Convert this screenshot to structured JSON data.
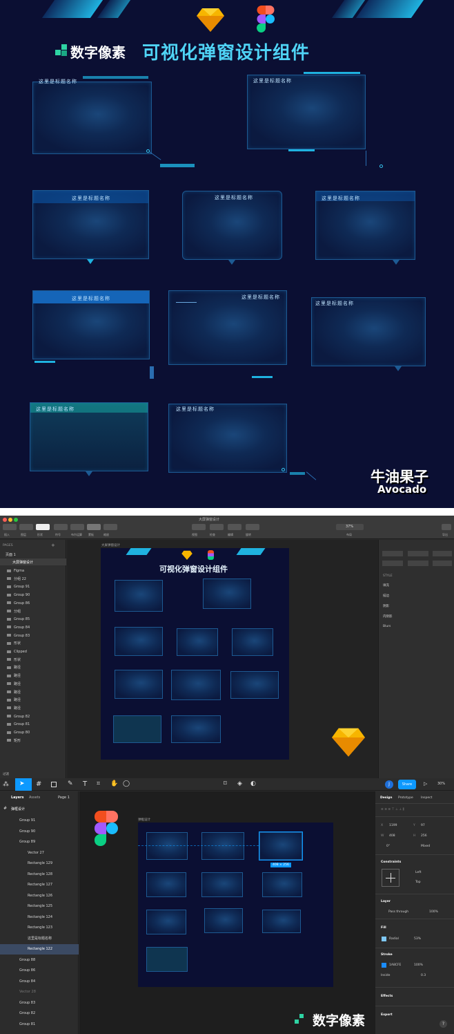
{
  "poster": {
    "brand_name": "数字像素",
    "headline": "可视化弹窗设计组件",
    "frame_title": "这里是标题名称",
    "watermark_line1": "牛油果子",
    "watermark_line2": "Avocado"
  },
  "sketch": {
    "window_title": "大屏弹窗设计",
    "toolbar": [
      "插入",
      "图层",
      "形状",
      "符号",
      "布尔运算",
      "蒙板",
      "缩放",
      "视图",
      "检查",
      "编辑",
      "旋转",
      "变换",
      "布局",
      "更多",
      "显示",
      "导出"
    ],
    "zoom": "37%",
    "pages_header": "PAGES",
    "page_name": "页面 1",
    "artboard_name": "大屏弹窗设计",
    "layers": [
      "Figma",
      "分组 22",
      "Group 91",
      "Group 90",
      "Group 86",
      "分组",
      "Group 85",
      "Group 84",
      "Group 83",
      "形状",
      "Clipped",
      "形状",
      "路径",
      "路径",
      "路径",
      "路径",
      "路径",
      "路径",
      "Group 82",
      "Group 81",
      "Group 80",
      "矩形"
    ],
    "style_header": "STYLE",
    "style_items": [
      "填充",
      "描边",
      "阴影",
      "内阴影",
      "Blurs"
    ],
    "bottom_label": "过滤"
  },
  "figma": {
    "tabs": [
      "Layers",
      "Assets"
    ],
    "page_select": "Page 1",
    "frame_name": "弹框设计",
    "layers": [
      "Group 91",
      "Group 90",
      "Group 89",
      "Vector 27",
      "Rectangle 129",
      "Rectangle 128",
      "Rectangle 127",
      "Rectangle 126",
      "Rectangle 125",
      "Rectangle 124",
      "Rectangle 123",
      "这里是标题名称",
      "Rectangle 122",
      "Group 88",
      "Group 86",
      "Group 84",
      "Vector 28",
      "Group 83",
      "Group 82",
      "Group 81"
    ],
    "share_label": "Share",
    "zoom": "30%",
    "avatar_letter": "J",
    "right_tabs": [
      "Design",
      "Prototype",
      "Inspect"
    ],
    "props": {
      "x_label": "X",
      "x": "1199",
      "y_label": "Y",
      "y": "97",
      "w_label": "W",
      "w": "408",
      "h_label": "H",
      "h": "256",
      "rot": "0°",
      "radius": "Mixed"
    },
    "selection_size": "408 × 256",
    "constraints_header": "Constraints",
    "constraint_h": "Left",
    "constraint_v": "Top",
    "layer_header": "Layer",
    "blend": "Pass through",
    "opacity": "100%",
    "fill_header": "Fill",
    "fill_type": "Radial",
    "fill_opacity": "53%",
    "stroke_header": "Stroke",
    "stroke_color": "1A8CFE",
    "stroke_opacity": "100%",
    "stroke_pos": "Inside",
    "stroke_width": "0.3",
    "effects_header": "Effects",
    "export_header": "Export",
    "brand_footer": "数字像素"
  },
  "colors": {
    "poster_bg": "#0b0f33",
    "accent": "#1fb2e0",
    "frame_border": "#1d5a93",
    "brand_green": "#2ed3a3",
    "figma_blue": "#0d99ff"
  }
}
